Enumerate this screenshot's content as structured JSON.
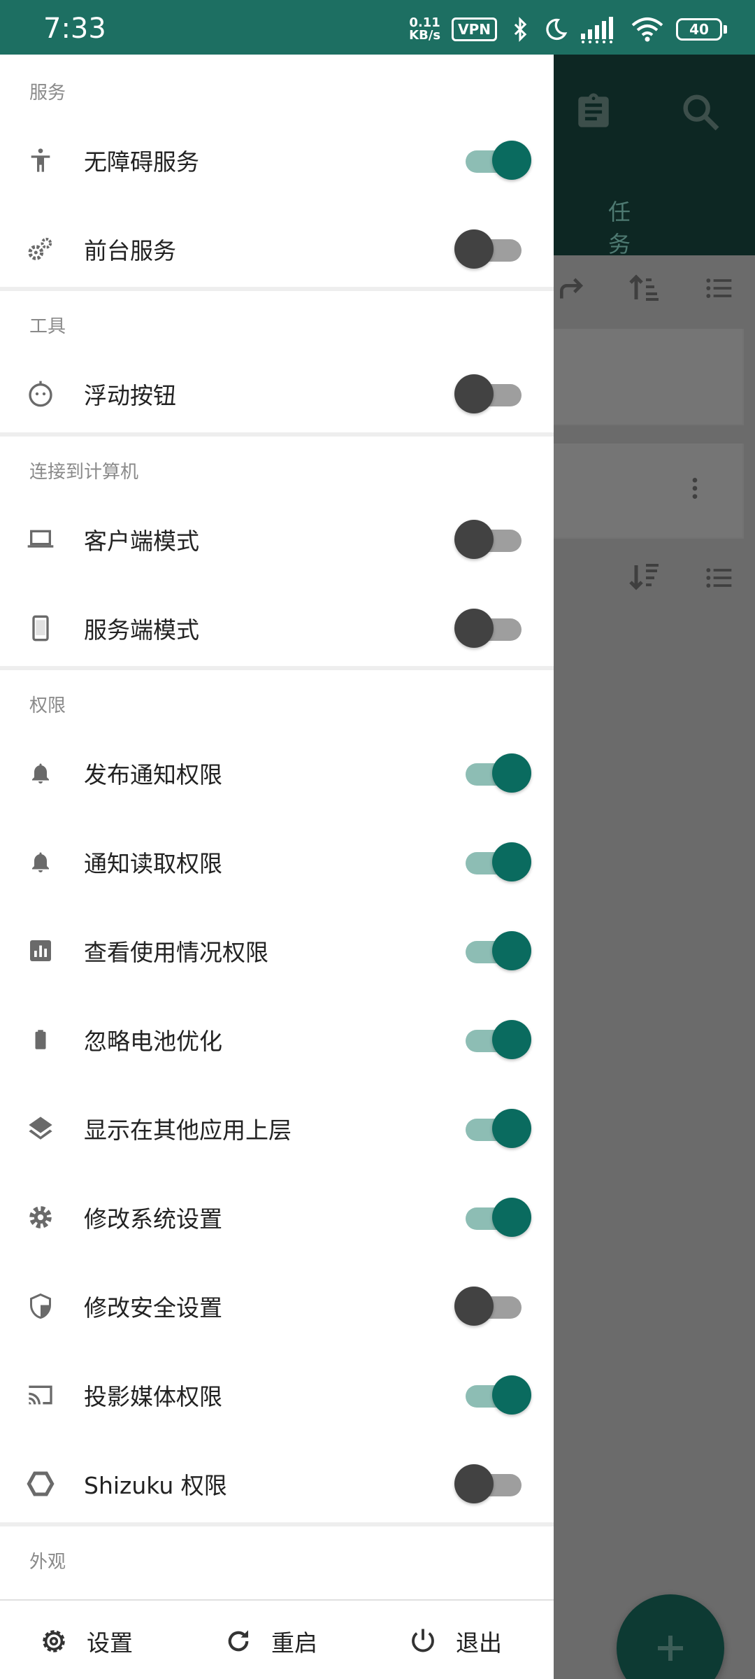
{
  "status_bar": {
    "time": "7:33",
    "net_speed_value": "0.11",
    "net_speed_unit": "KB/s",
    "vpn": "VPN",
    "battery": "40"
  },
  "background_app": {
    "tab_label": "任务"
  },
  "drawer": {
    "sections": {
      "services": "服务",
      "tools": "工具",
      "connect": "连接到计算机",
      "permissions": "权限",
      "appearance": "外观"
    },
    "items": {
      "accessibility_service": {
        "label": "无障碍服务",
        "icon": "accessibility-icon",
        "on": true
      },
      "foreground_service": {
        "label": "前台服务",
        "icon": "gears-icon",
        "on": false
      },
      "floating_button": {
        "label": "浮动按钮",
        "icon": "floating-face-icon",
        "on": false
      },
      "client_mode": {
        "label": "客户端模式",
        "icon": "laptop-icon",
        "on": false
      },
      "server_mode": {
        "label": "服务端模式",
        "icon": "phone-icon",
        "on": false
      },
      "post_notification": {
        "label": "发布通知权限",
        "icon": "bell-icon",
        "on": true
      },
      "read_notification": {
        "label": "通知读取权限",
        "icon": "bell-icon",
        "on": true
      },
      "usage_stats": {
        "label": "查看使用情况权限",
        "icon": "chart-icon",
        "on": true
      },
      "ignore_battery": {
        "label": "忽略电池优化",
        "icon": "battery-icon",
        "on": true
      },
      "overlay": {
        "label": "显示在其他应用上层",
        "icon": "layers-icon",
        "on": true
      },
      "write_settings": {
        "label": "修改系统设置",
        "icon": "gear-icon",
        "on": true
      },
      "secure_settings": {
        "label": "修改安全设置",
        "icon": "shield-icon",
        "on": false
      },
      "media_projection": {
        "label": "投影媒体权限",
        "icon": "cast-icon",
        "on": true
      },
      "shizuku": {
        "label": "Shizuku 权限",
        "icon": "hexagon-icon",
        "on": false
      }
    },
    "bottom_bar": {
      "settings": "设置",
      "restart": "重启",
      "exit": "退出"
    }
  },
  "colors": {
    "accent": "#0a6b5f",
    "status_bar": "#1d6f62",
    "switch_on_track": "#8dbdb4",
    "switch_off_thumb": "#424242"
  }
}
